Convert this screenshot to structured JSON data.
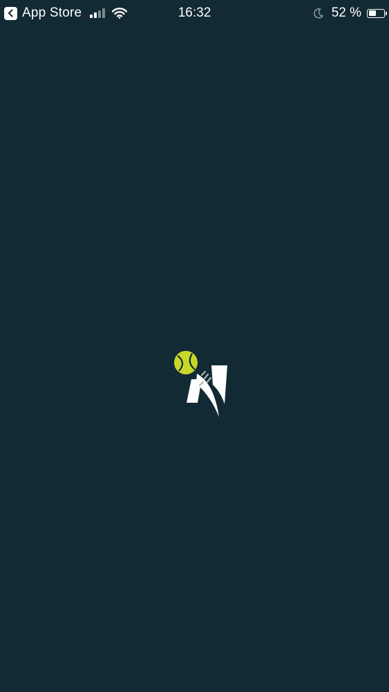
{
  "status_bar": {
    "back_app_label": "App Store",
    "time": "16:32",
    "battery_text": "52 %",
    "battery_level": 0.52,
    "cellular_bars": 4,
    "cellular_bars_active": 2,
    "icons": [
      "back-chevron-icon",
      "cellular-signal-icon",
      "wifi-icon",
      "do-not-disturb-moon-icon",
      "battery-icon"
    ]
  },
  "splash": {
    "logo_icon": "tennis-ball-n-logo",
    "colors": {
      "background": "#122a33",
      "ball": "#c8d72a",
      "letter": "#ffffff"
    }
  }
}
